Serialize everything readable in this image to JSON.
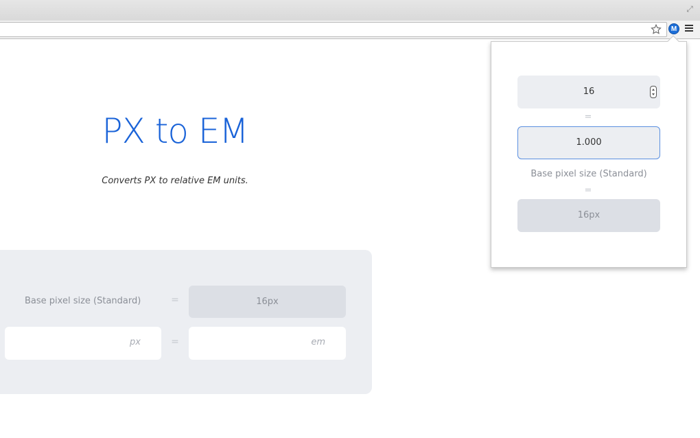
{
  "browser": {
    "extension_icon_letter": "M"
  },
  "page": {
    "title": "PX to EM",
    "subtitle": "Converts PX to relative EM units.",
    "converter": {
      "base_label": "Base pixel size (Standard)",
      "equals": "=",
      "base_value": "16px",
      "px_unit": "px",
      "em_unit": "em"
    }
  },
  "popup": {
    "px_value": "16",
    "equals": "=",
    "em_value": "1.000",
    "base_label": "Base pixel size (Standard)",
    "base_value": "16px"
  },
  "colors": {
    "accent": "#1a63d8",
    "panel": "#eceef2",
    "base_field": "#dcdfe5"
  },
  "icons": [
    "expand-icon",
    "star-icon",
    "extension-icon",
    "chrome-menu-icon",
    "spinner-icon"
  ]
}
